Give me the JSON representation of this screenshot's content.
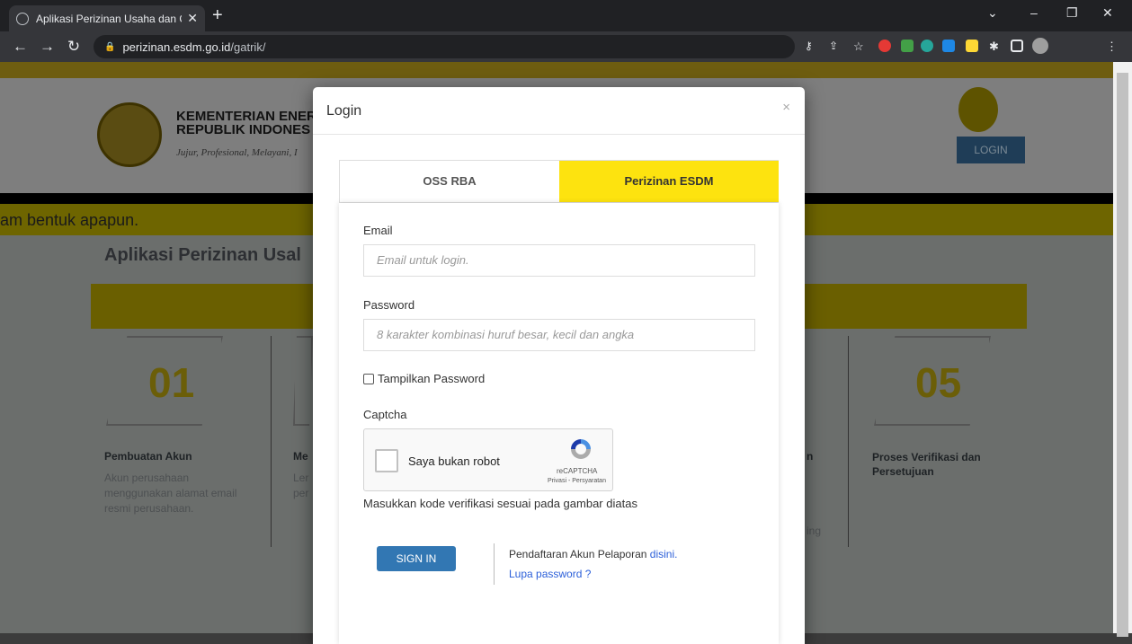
{
  "browser": {
    "tab_title": "Aplikasi Perizinan Usaha dan Ope",
    "url_host": "perizinan.esdm.go.id",
    "url_path": "/gatrik/"
  },
  "page": {
    "org_line1": "KEMENTERIAN ENER",
    "org_line2": "REPUBLIK INDONES",
    "org_motto": "Jujur, Profesional, Melayani, I",
    "login_button": "LOGIN",
    "marquee": "am bentuk apapun.",
    "app_title": "Aplikasi Perizinan Usal",
    "step1_num": "01",
    "step1_title": "Pembuatan Akun",
    "step1_desc": "Akun perusahaan menggunakan alamat email resmi perusahaan.",
    "step2_title": "Me",
    "step2_desc": "Ler per",
    "step5_num": "05",
    "step5_title": "Proses Verifikasi dan Persetujuan",
    "step4_frag": "n",
    "step4_frag2": "ing"
  },
  "modal": {
    "title": "Login",
    "close": "×",
    "tab_oss": "OSS RBA",
    "tab_esdm": "Perizinan ESDM",
    "email_label": "Email",
    "email_placeholder": "Email untuk login.",
    "password_label": "Password",
    "password_placeholder": "8 karakter kombinasi huruf besar, kecil dan angka",
    "show_password": "Tampilkan Password",
    "captcha_label": "Captcha",
    "recaptcha_text": "Saya bukan robot",
    "recaptcha_brand": "reCAPTCHA",
    "recaptcha_terms": "Privasi - Persyaratan",
    "captcha_hint": "Masukkan kode verifikasi sesuai pada gambar diatas",
    "signin": "SIGN IN",
    "register_text": "Pendaftaran Akun Pelaporan ",
    "register_link": "disini.",
    "forgot": "Lupa password ?"
  }
}
